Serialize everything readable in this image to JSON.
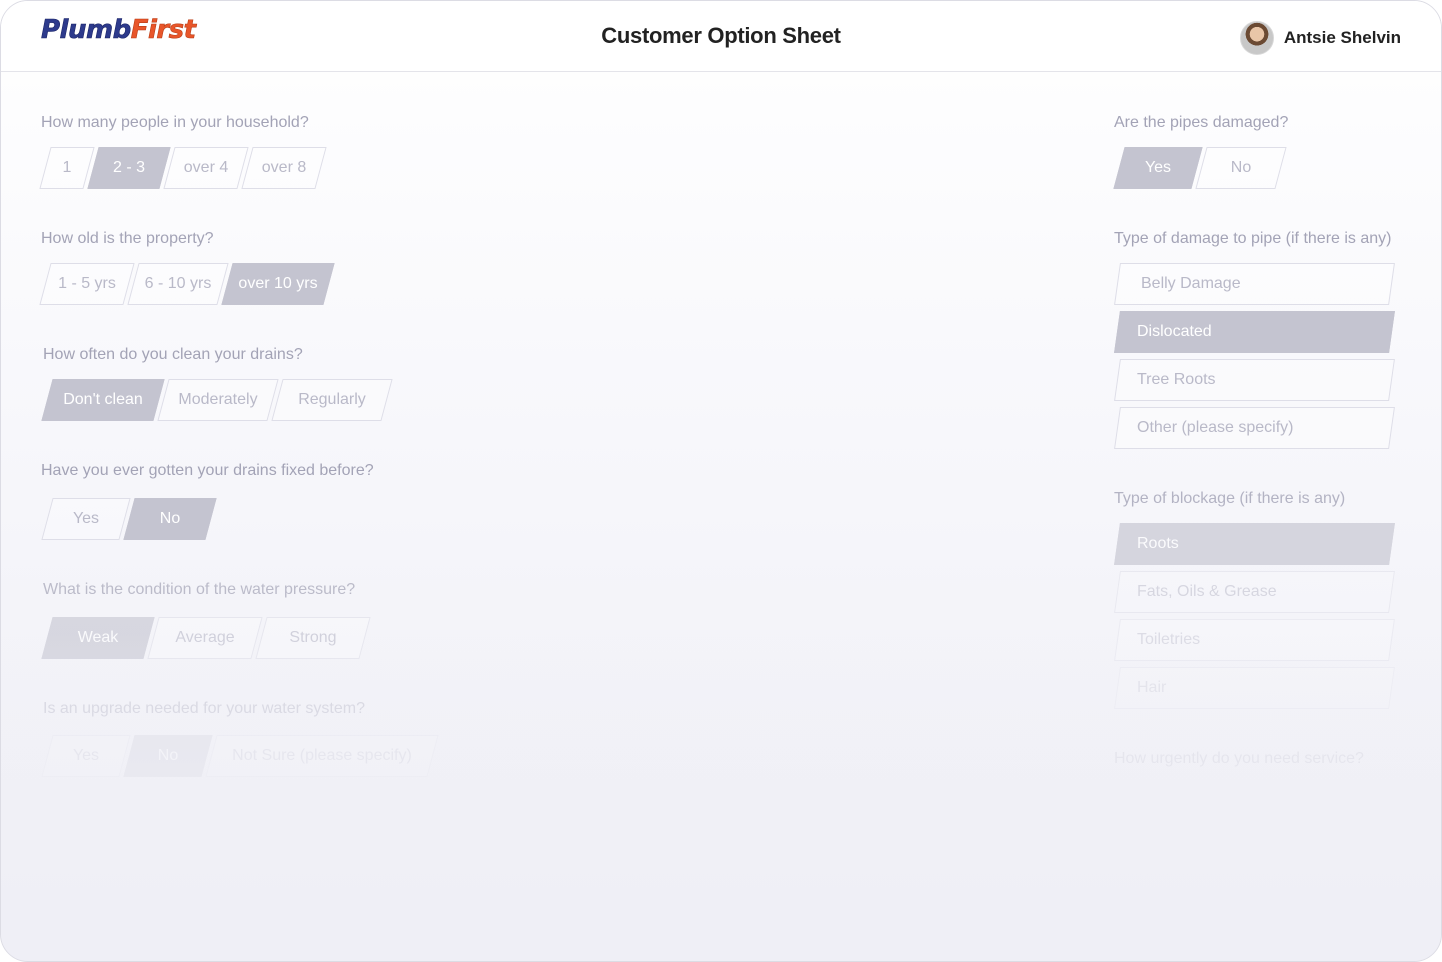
{
  "header": {
    "logo_part1": "Plumb",
    "logo_part2": "First",
    "title": "Customer Option Sheet",
    "user_name": "Antsie Shelvin"
  },
  "left": [
    {
      "question": "How many people in your household?",
      "options": [
        "1",
        "2 - 3",
        "over 4",
        "over 8"
      ],
      "selected": 1
    },
    {
      "question": "How old is the property?",
      "options": [
        "1 - 5 yrs",
        "6 - 10 yrs",
        "over 10 yrs"
      ],
      "selected": 2
    },
    {
      "question": "How often do you clean your drains?",
      "options": [
        "Don't clean",
        "Moderately",
        "Regularly"
      ],
      "selected": 0
    },
    {
      "question": "Have you ever gotten your drains fixed before?",
      "options": [
        "Yes",
        "No"
      ],
      "selected": 1
    },
    {
      "question": "What is the condition of the water pressure?",
      "options": [
        "Weak",
        "Average",
        "Strong"
      ],
      "selected": 0
    },
    {
      "question": "Is an upgrade needed for your water system?",
      "options": [
        "Yes",
        "No",
        "Not Sure (please specify)"
      ],
      "selected": 1
    }
  ],
  "right": {
    "pipes_question": "Are the pipes damaged?",
    "pipes_options": [
      "Yes",
      "No"
    ],
    "pipes_selected": 0,
    "damage_question": "Type of damage to pipe (if there is any)",
    "damage_options": [
      "Belly Damage",
      "Dislocated",
      "Tree Roots",
      "Other (please specify)"
    ],
    "damage_selected": 1,
    "blockage_question": "Type of blockage (if there is any)",
    "blockage_options": [
      "Roots",
      "Fats, Oils & Grease",
      "Toiletries",
      "Hair"
    ],
    "blockage_selected": 0,
    "last_question": "How urgently do you need service?"
  }
}
